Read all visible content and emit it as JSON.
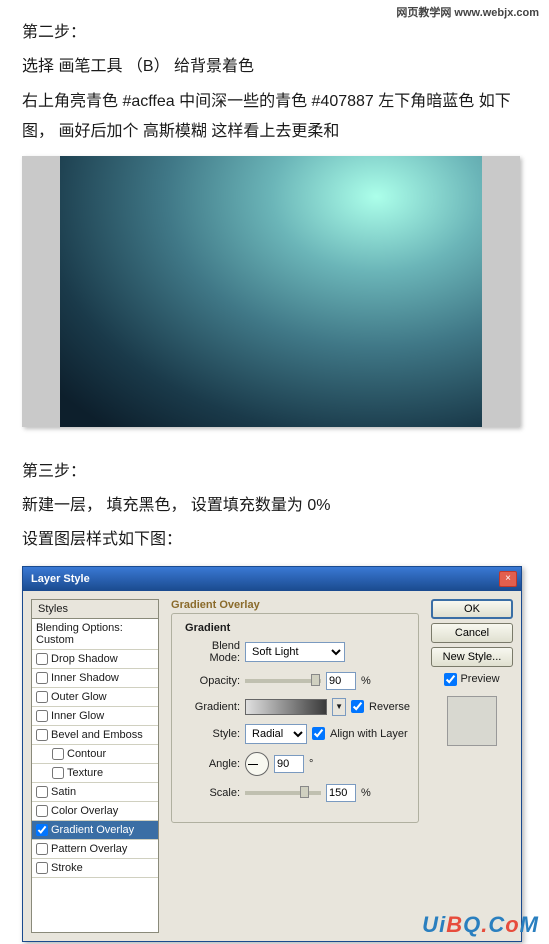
{
  "watermarks": {
    "top": "网页教学网\nwww.webjx.com",
    "bottom": "UiBQ.CoM"
  },
  "step2": {
    "title": "第二步：",
    "line1_a": "选择  画笔工具 （B）  给背景着色",
    "line2": "右上角亮青色 #acffea   中间深一些的青色 #407887  左下角暗蓝色 如下图，  画好后加个   高斯模糊  这样看上去更柔和"
  },
  "step3": {
    "title": "第三步：",
    "line1": "新建一层，  填充黑色，  设置填充数量为 0%",
    "line2": "设置图层样式如下图："
  },
  "dialog": {
    "title": "Layer Style",
    "close": "×",
    "styles_header": "Styles",
    "blending": "Blending Options: Custom",
    "list": [
      {
        "label": "Drop Shadow",
        "checked": false,
        "indent": false
      },
      {
        "label": "Inner Shadow",
        "checked": false,
        "indent": false
      },
      {
        "label": "Outer Glow",
        "checked": false,
        "indent": false
      },
      {
        "label": "Inner Glow",
        "checked": false,
        "indent": false
      },
      {
        "label": "Bevel and Emboss",
        "checked": false,
        "indent": false
      },
      {
        "label": "Contour",
        "checked": false,
        "indent": true
      },
      {
        "label": "Texture",
        "checked": false,
        "indent": true
      },
      {
        "label": "Satin",
        "checked": false,
        "indent": false
      },
      {
        "label": "Color Overlay",
        "checked": false,
        "indent": false
      },
      {
        "label": "Gradient Overlay",
        "checked": true,
        "indent": false,
        "selected": true
      },
      {
        "label": "Pattern Overlay",
        "checked": false,
        "indent": false
      },
      {
        "label": "Stroke",
        "checked": false,
        "indent": false
      }
    ],
    "panel": {
      "title": "Gradient Overlay",
      "group": "Gradient",
      "blend_mode_label": "Blend Mode:",
      "blend_mode_value": "Soft Light",
      "opacity_label": "Opacity:",
      "opacity_value": "90",
      "opacity_unit": "%",
      "gradient_label": "Gradient:",
      "reverse_label": "Reverse",
      "style_label": "Style:",
      "style_value": "Radial",
      "align_label": "Align with Layer",
      "angle_label": "Angle:",
      "angle_value": "90",
      "angle_unit": "°",
      "scale_label": "Scale:",
      "scale_value": "150",
      "scale_unit": "%"
    },
    "buttons": {
      "ok": "OK",
      "cancel": "Cancel",
      "new_style": "New Style...",
      "preview": "Preview"
    }
  }
}
